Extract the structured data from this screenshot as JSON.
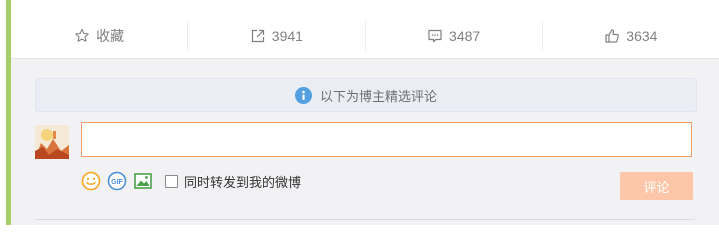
{
  "actions": [
    {
      "name": "favorite",
      "icon": "star-outline-icon",
      "label": "收藏"
    },
    {
      "name": "repost",
      "icon": "share-icon",
      "label": "3941"
    },
    {
      "name": "comment",
      "icon": "comment-icon",
      "label": "3487"
    },
    {
      "name": "like",
      "icon": "thumbs-up-icon",
      "label": "3634"
    }
  ],
  "notice": {
    "icon": "info-icon",
    "text": "以下为博主精选评论"
  },
  "comment_box": {
    "value": "",
    "placeholder": ""
  },
  "toolbar": {
    "emoji_icon": "emoji-icon",
    "gif_icon": "gif-icon",
    "image_icon": "image-icon",
    "sync_label": "同时转发到我的微博",
    "sync_checked": false,
    "submit_label": "评论"
  },
  "colors": {
    "accent_bar": "#a7cd6a",
    "input_border": "#f09e6c",
    "submit_bg": "#fdc6a8",
    "info_blue": "#52a0e0"
  }
}
